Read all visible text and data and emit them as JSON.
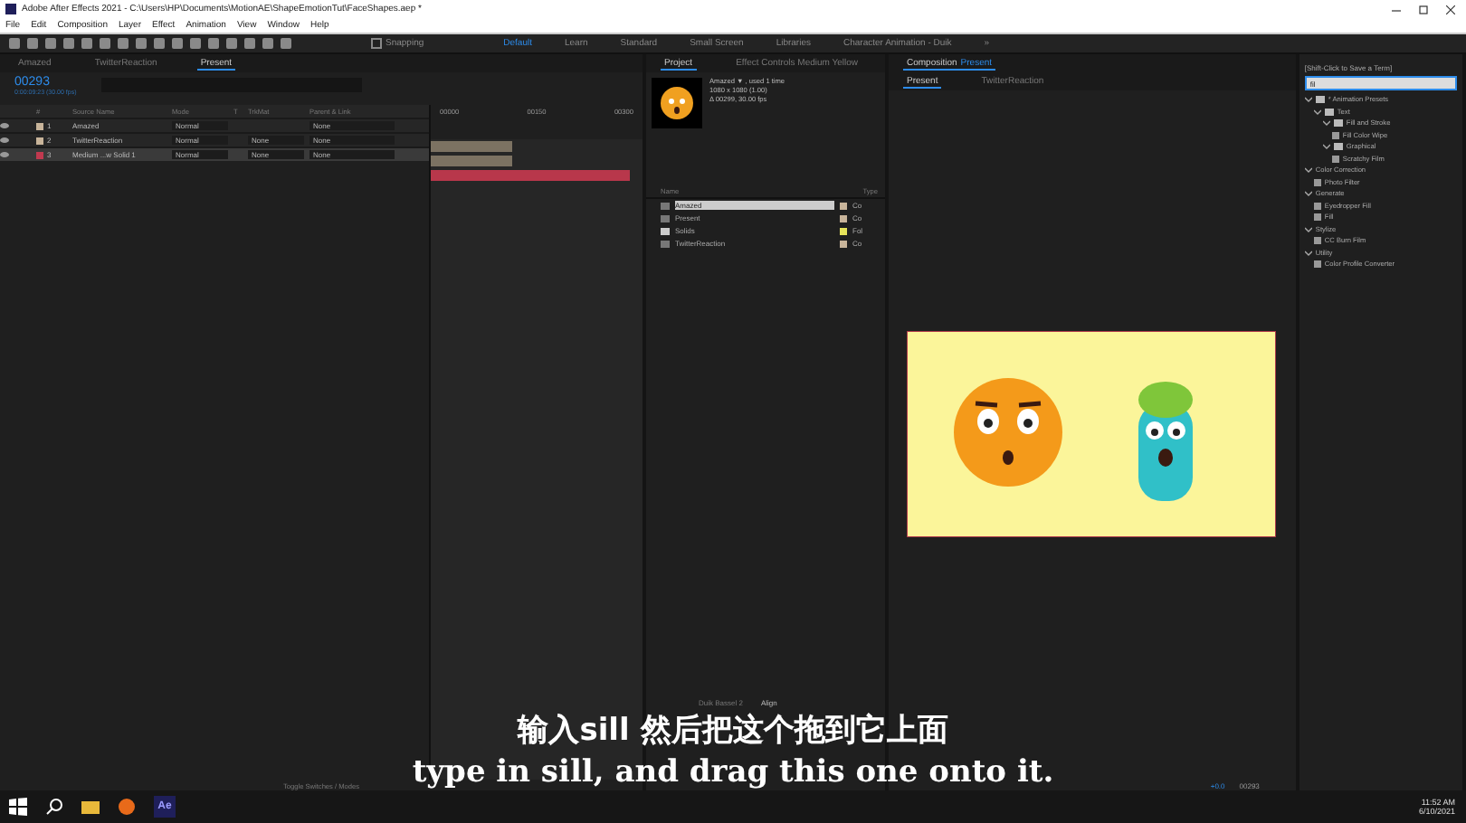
{
  "window": {
    "title": "Adobe After Effects 2021 - C:\\Users\\HP\\Documents\\MotionAE\\ShapeEmotionTut\\FaceShapes.aep *"
  },
  "menu": [
    "File",
    "Edit",
    "Composition",
    "Layer",
    "Effect",
    "Animation",
    "View",
    "Window",
    "Help"
  ],
  "toolbar": {
    "snapping": {
      "label": "Snapping",
      "checked": false
    }
  },
  "workspaces": [
    {
      "label": "Default",
      "selected": true
    },
    {
      "label": "Learn",
      "selected": false
    },
    {
      "label": "Standard",
      "selected": false
    },
    {
      "label": "Small Screen",
      "selected": false
    },
    {
      "label": "Libraries",
      "selected": false
    },
    {
      "label": "Character Animation - Duik",
      "selected": false
    }
  ],
  "workspaces_more": "»",
  "timeline": {
    "tabs": [
      {
        "label": "Amazed",
        "selected": false
      },
      {
        "label": "TwitterReaction",
        "selected": false
      },
      {
        "label": "Present",
        "selected": true
      }
    ],
    "timecode": "00293",
    "timecode_sub": "0:00:09:23 (30.00 fps)",
    "columns": [
      "#",
      "Source Name",
      "Mode",
      "T",
      "TrkMat",
      "Parent & Link"
    ],
    "ruler": [
      "00000",
      "00150",
      "00300"
    ],
    "layers": [
      {
        "index": "1",
        "name": "Amazed",
        "mode": "Normal",
        "parent": "None",
        "color": "#c8b49a",
        "selected": false
      },
      {
        "index": "2",
        "name": "TwitterReaction",
        "mode": "Normal",
        "trkmat": "None",
        "parent": "None",
        "color": "#c8b49a",
        "selected": false
      },
      {
        "index": "3",
        "name": "Medium ...w Solid 1",
        "mode": "Normal",
        "trkmat": "None",
        "parent": "None",
        "color": "#c0394f",
        "selected": true
      }
    ],
    "footer": "Toggle Switches / Modes"
  },
  "project": {
    "tabs": [
      {
        "label": "Project",
        "selected": true
      },
      {
        "label": "Effect Controls Medium Yellow",
        "selected": false
      }
    ],
    "info": [
      "Amazed ▼ , used 1 time",
      "1080 x 1080 (1.00)",
      "Δ 00299, 30.00 fps"
    ],
    "columns": [
      "Name",
      "Type"
    ],
    "items": [
      {
        "name": "Amazed",
        "kind": "comp",
        "type": "Co",
        "color": "#c8b49a",
        "selected": true
      },
      {
        "name": "Present",
        "kind": "comp",
        "type": "Co",
        "color": "#c8b49a",
        "selected": false
      },
      {
        "name": "Solids",
        "kind": "folder",
        "type": "Fol",
        "color": "#e6e45a",
        "selected": false
      },
      {
        "name": "TwitterReaction",
        "kind": "comp",
        "type": "Co",
        "color": "#c8b49a",
        "selected": false
      }
    ]
  },
  "composition": {
    "title": "Composition",
    "comp_name": "Present",
    "tabs": [
      {
        "label": "Present",
        "selected": true
      },
      {
        "label": "TwitterReaction",
        "selected": false
      }
    ],
    "exposure": "+0.0",
    "timecode": "00293"
  },
  "lower_panels": [
    {
      "label": "Duik Bassel 2",
      "selected": false
    },
    {
      "label": "Align",
      "selected": true
    }
  ],
  "effects": {
    "hint": "[Shift-Click to Save a Term]",
    "search": "fil",
    "tree": [
      {
        "label": "* Animation Presets",
        "kind": "folder",
        "expanded": true,
        "children": [
          {
            "label": "Text",
            "kind": "folder",
            "expanded": true,
            "children": [
              {
                "label": "Fill and Stroke",
                "kind": "folder",
                "expanded": true,
                "children": [
                  {
                    "label": "Fill Color Wipe",
                    "kind": "preset"
                  }
                ]
              },
              {
                "label": "Graphical",
                "kind": "folder",
                "expanded": true,
                "children": [
                  {
                    "label": "Scratchy Film",
                    "kind": "preset"
                  }
                ]
              }
            ]
          }
        ]
      },
      {
        "label": "Color Correction",
        "kind": "group",
        "expanded": true,
        "children": [
          {
            "label": "Photo Filter",
            "kind": "effect"
          }
        ]
      },
      {
        "label": "Generate",
        "kind": "group",
        "expanded": true,
        "children": [
          {
            "label": "Eyedropper Fill",
            "kind": "effect"
          },
          {
            "label": "Fill",
            "kind": "effect"
          }
        ]
      },
      {
        "label": "Stylize",
        "kind": "group",
        "expanded": true,
        "children": [
          {
            "label": "CC Burn Film",
            "kind": "effect"
          }
        ]
      },
      {
        "label": "Utility",
        "kind": "group",
        "expanded": true,
        "children": [
          {
            "label": "Color Profile Converter",
            "kind": "effect"
          }
        ]
      }
    ]
  },
  "subtitles": [
    "输入sill 然后把这个拖到它上面",
    "type in sill, and drag this one onto it."
  ],
  "taskbar": {
    "time": "11:52 AM",
    "date": "6/10/2021",
    "app_label": "Ae"
  }
}
